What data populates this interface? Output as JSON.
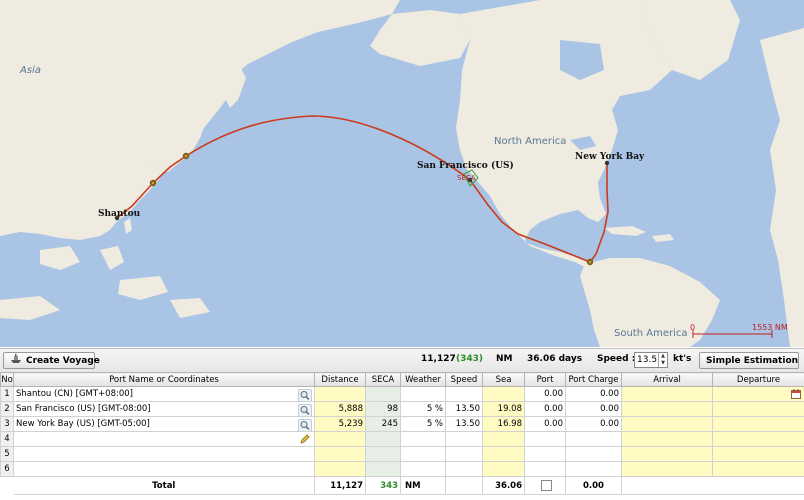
{
  "map": {
    "labels": {
      "asia": "Asia",
      "north_america": "North America",
      "south_america": "South America",
      "seca": "SECA"
    },
    "ports": {
      "shantou": "Shantou",
      "san_francisco": "San Francisco (US)",
      "new_york": "New York Bay"
    },
    "scale": {
      "zero": "0",
      "distance": "1553 NM"
    },
    "colors": {
      "ocean": "#a9c4e4",
      "land": "#efebe0",
      "route": "#cc3a1a",
      "label_blue": "#5a7796"
    }
  },
  "toolbar": {
    "create_label": "Create Voyage",
    "total_distance": "11,127",
    "seca_distance": "(343)",
    "nm_label": "NM",
    "days": "36.06 days",
    "speed_label": "Speed :",
    "speed_value": "13.5",
    "kts_label": "kt's",
    "simple_estimation_label": "Simple Estimation"
  },
  "table": {
    "headers": [
      "No",
      "Port Name or Coordinates",
      "Distance",
      "SECA",
      "Weather",
      "Speed",
      "Sea",
      "Port",
      "Port Charge",
      "Arrival",
      "Departure"
    ],
    "rows": [
      {
        "no": "1",
        "port": "Shantou (CN) [GMT+08:00]",
        "distance": "",
        "seca": "",
        "weather": "",
        "speed": "",
        "sea": "",
        "port_days": "0.00",
        "port_charge": "0.00",
        "arrival": "",
        "departure": ""
      },
      {
        "no": "2",
        "port": "San Francisco (US) [GMT-08:00]",
        "distance": "5,888",
        "seca": "98",
        "weather": "5 %",
        "speed": "13.50",
        "sea": "19.08",
        "port_days": "0.00",
        "port_charge": "0.00",
        "arrival": "",
        "departure": ""
      },
      {
        "no": "3",
        "port": "New York Bay (US) [GMT-05:00]",
        "distance": "5,239",
        "seca": "245",
        "weather": "5 %",
        "speed": "13.50",
        "sea": "16.98",
        "port_days": "0.00",
        "port_charge": "0.00",
        "arrival": "",
        "departure": ""
      },
      {
        "no": "4",
        "port": "",
        "distance": "",
        "seca": "",
        "weather": "",
        "speed": "",
        "sea": "",
        "port_days": "",
        "port_charge": "",
        "arrival": "",
        "departure": ""
      },
      {
        "no": "5",
        "port": "",
        "distance": "",
        "seca": "",
        "weather": "",
        "speed": "",
        "sea": "",
        "port_days": "",
        "port_charge": "",
        "arrival": "",
        "departure": ""
      },
      {
        "no": "6",
        "port": "",
        "distance": "",
        "seca": "",
        "weather": "",
        "speed": "",
        "sea": "",
        "port_days": "",
        "port_charge": "",
        "arrival": "",
        "departure": ""
      }
    ],
    "total": {
      "label": "Total",
      "distance": "11,127",
      "seca": "343",
      "nm": "NM",
      "sea": "36.06",
      "port_charge": "0.00"
    }
  }
}
